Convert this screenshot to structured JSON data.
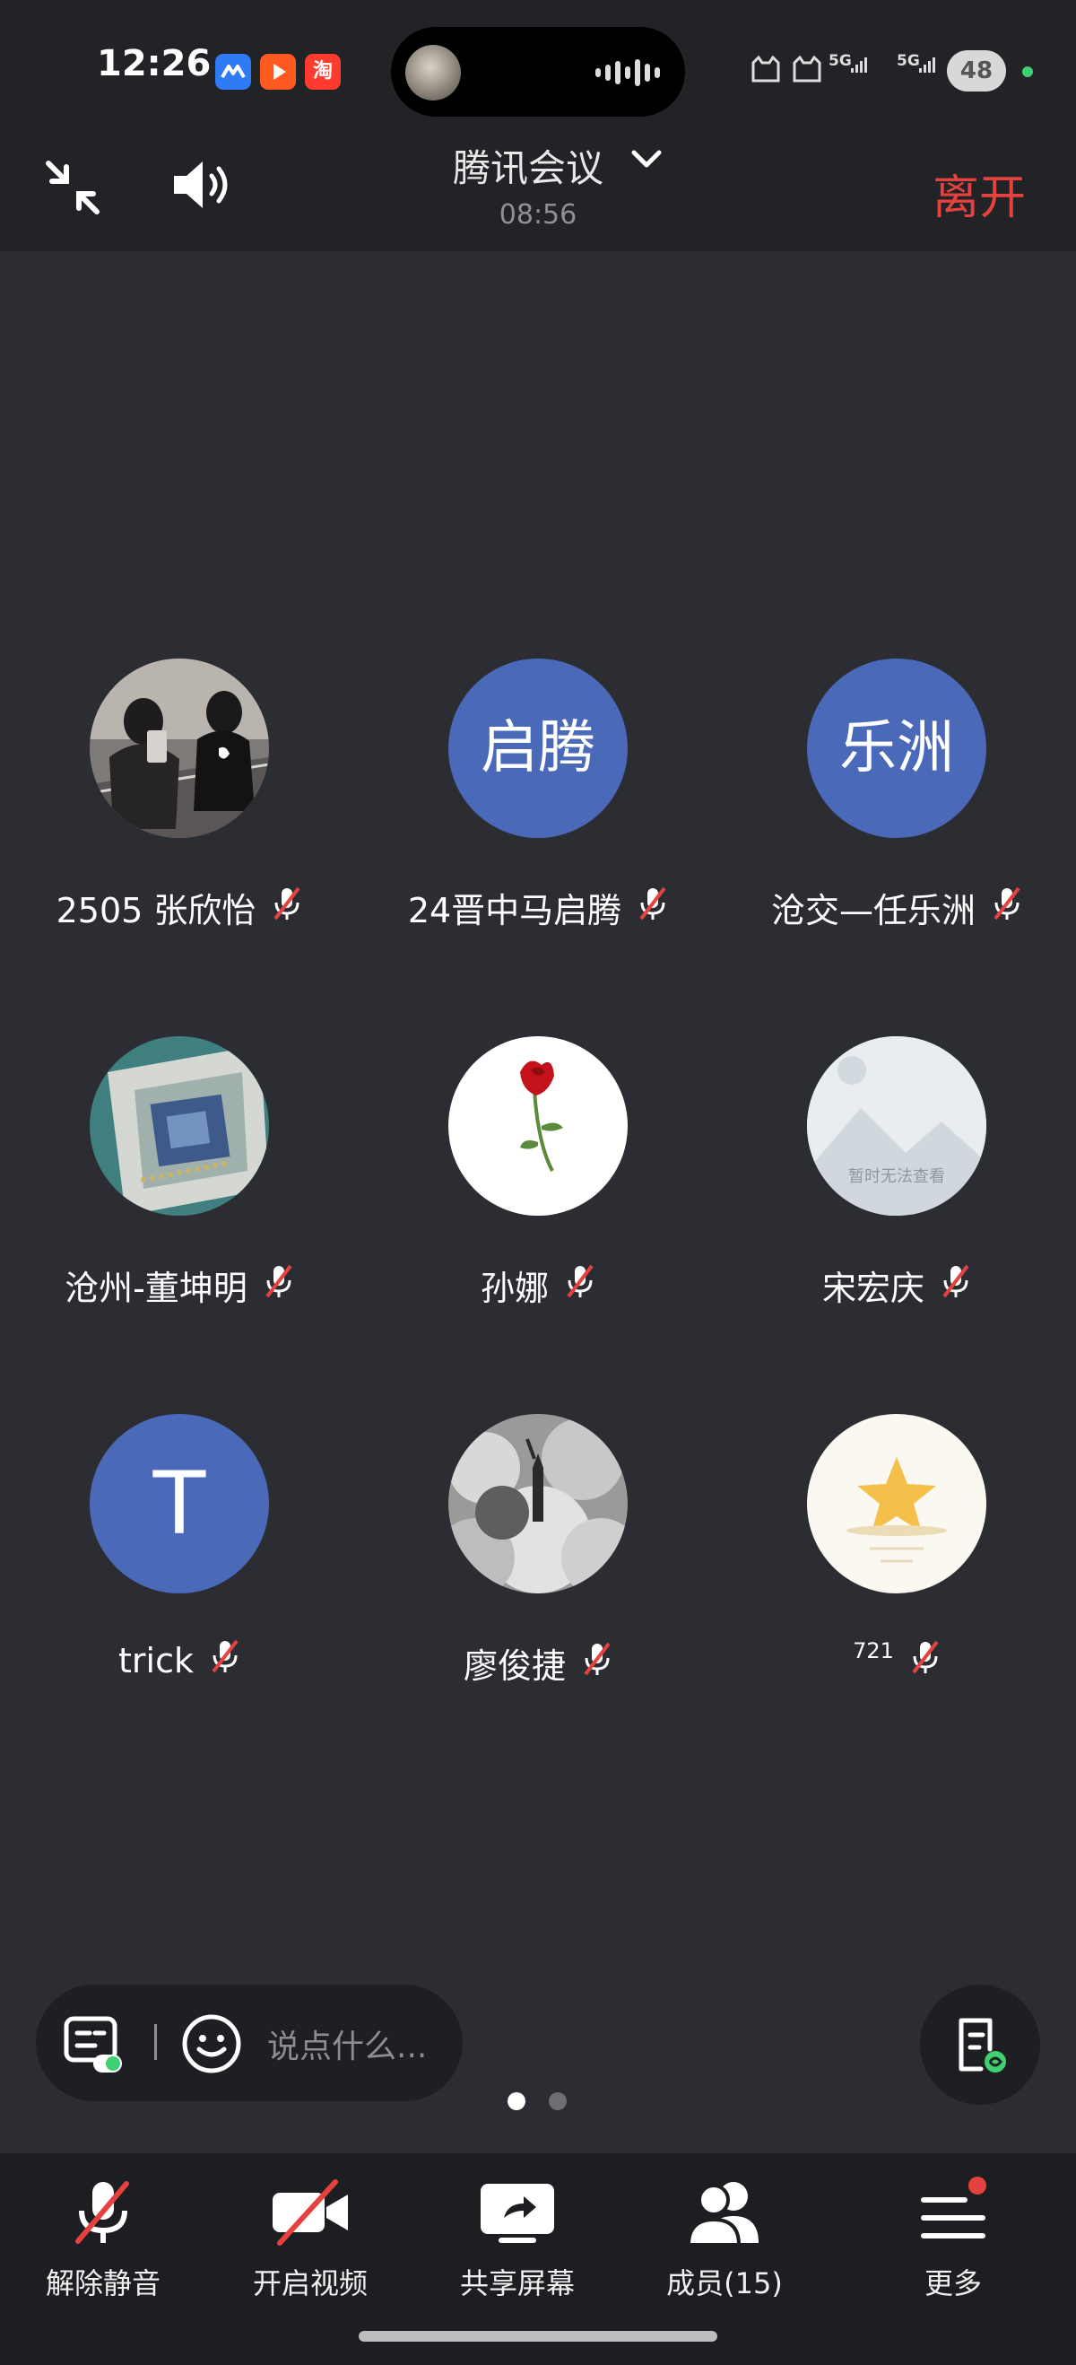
{
  "status_bar": {
    "time": "12:26",
    "apps": [
      {
        "icon": "meeting-app-icon",
        "label": "",
        "color": "#2f7bf5"
      },
      {
        "icon": "video-app-icon",
        "label": "",
        "color": "#ff5a1f"
      },
      {
        "icon": "taobao-app-icon",
        "label": "淘",
        "color": "#ff3b2f"
      }
    ],
    "signal1": "5G",
    "signal2": "5G",
    "battery": "48"
  },
  "header": {
    "title": "腾讯会议",
    "duration": "08:56",
    "leave_label": "离开",
    "leave_color": "#e5423f"
  },
  "participants": [
    {
      "name": "2505 张欣怡",
      "avatar_type": "photo",
      "avatar_text": "",
      "muted": true
    },
    {
      "name": "24晋中马启腾",
      "avatar_type": "text",
      "avatar_text": "启腾",
      "muted": true
    },
    {
      "name": "沧交—任乐洲",
      "avatar_type": "text",
      "avatar_text": "乐洲",
      "muted": true
    },
    {
      "name": "沧州-董坤明",
      "avatar_type": "photo",
      "avatar_text": "",
      "muted": true
    },
    {
      "name": "孙娜",
      "avatar_type": "photo",
      "avatar_text": "",
      "muted": true
    },
    {
      "name": "宋宏庆",
      "avatar_type": "placeholder",
      "avatar_text": "暂时无法查看",
      "muted": true
    },
    {
      "name": "trick",
      "avatar_type": "text",
      "avatar_text": "T",
      "muted": true
    },
    {
      "name": "廖俊捷",
      "avatar_type": "photo",
      "avatar_text": "",
      "muted": true
    },
    {
      "name": "721",
      "avatar_type": "photo",
      "avatar_text": "",
      "muted": true
    }
  ],
  "chat": {
    "placeholder": "说点什么..."
  },
  "pages": {
    "count": 2,
    "active": 0
  },
  "toolbar": {
    "unmute": "解除静音",
    "video": "开启视频",
    "share": "共享屏幕",
    "members": "成员(15)",
    "more": "更多"
  },
  "colors": {
    "avatar_blue": "#4a69b8",
    "background": "#2c2d32",
    "bar": "#222326",
    "badge_red": "#e5423f"
  }
}
